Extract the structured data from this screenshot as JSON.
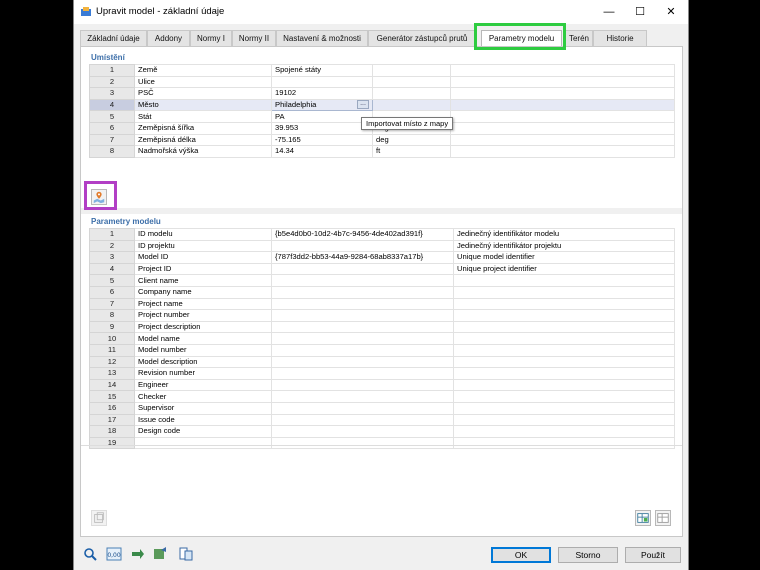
{
  "window": {
    "title": "Upravit model - základní údaje",
    "minimize": "—",
    "maximize": "☐",
    "close": "✕"
  },
  "tabs": [
    {
      "label": "Základní údaje"
    },
    {
      "label": "Addony"
    },
    {
      "label": "Normy I"
    },
    {
      "label": "Normy II"
    },
    {
      "label": "Nastavení & možnosti"
    },
    {
      "label": "Generátor zástupců prutů"
    },
    {
      "label": "Parametry modelu",
      "active": true
    },
    {
      "label": "Terén"
    },
    {
      "label": "Historie"
    }
  ],
  "location": {
    "title": "Umístění",
    "rows": [
      {
        "no": "1",
        "name": "Země",
        "value": "Spojené státy",
        "unit": ""
      },
      {
        "no": "2",
        "name": "Ulice",
        "value": "",
        "unit": ""
      },
      {
        "no": "3",
        "name": "PSČ",
        "value": "19102",
        "unit": ""
      },
      {
        "no": "4",
        "name": "Město",
        "value": "Philadelphia",
        "unit": "",
        "selected": true
      },
      {
        "no": "5",
        "name": "Stát",
        "value": "PA",
        "unit": ""
      },
      {
        "no": "6",
        "name": "Zeměpisná šířka",
        "value": "39.953",
        "unit": "deg"
      },
      {
        "no": "7",
        "name": "Zeměpisná délka",
        "value": "-75.165",
        "unit": "deg"
      },
      {
        "no": "8",
        "name": "Nadmořská výška",
        "value": "14.34",
        "unit": "ft"
      }
    ],
    "tooltip": "Importovat místo z mapy",
    "dots": "..."
  },
  "model_params": {
    "title": "Parametry modelu",
    "rows": [
      {
        "no": "1",
        "name": "ID modelu",
        "value": "{b5e4d0b0-10d2-4b7c-9456-4de402ad391f}",
        "desc": "Jedinečný identifikátor modelu"
      },
      {
        "no": "2",
        "name": "ID projektu",
        "value": "",
        "desc": "Jedinečný identifikátor projektu"
      },
      {
        "no": "3",
        "name": "Model ID",
        "value": "{787f3dd2-bb53-44a9-9284-68ab8337a17b}",
        "desc": "Unique model identifier"
      },
      {
        "no": "4",
        "name": "Project ID",
        "value": "",
        "desc": "Unique project identifier"
      },
      {
        "no": "5",
        "name": "Client name",
        "value": "",
        "desc": ""
      },
      {
        "no": "6",
        "name": "Company name",
        "value": "",
        "desc": ""
      },
      {
        "no": "7",
        "name": "Project name",
        "value": "",
        "desc": ""
      },
      {
        "no": "8",
        "name": "Project number",
        "value": "",
        "desc": ""
      },
      {
        "no": "9",
        "name": "Project description",
        "value": "",
        "desc": ""
      },
      {
        "no": "10",
        "name": "Model name",
        "value": "",
        "desc": ""
      },
      {
        "no": "11",
        "name": "Model number",
        "value": "",
        "desc": ""
      },
      {
        "no": "12",
        "name": "Model description",
        "value": "",
        "desc": ""
      },
      {
        "no": "13",
        "name": "Revision number",
        "value": "",
        "desc": ""
      },
      {
        "no": "14",
        "name": "Engineer",
        "value": "",
        "desc": ""
      },
      {
        "no": "15",
        "name": "Checker",
        "value": "",
        "desc": ""
      },
      {
        "no": "16",
        "name": "Supervisor",
        "value": "",
        "desc": ""
      },
      {
        "no": "17",
        "name": "Issue code",
        "value": "",
        "desc": ""
      },
      {
        "no": "18",
        "name": "Design code",
        "value": "",
        "desc": ""
      },
      {
        "no": "19",
        "name": "",
        "value": "",
        "desc": ""
      }
    ]
  },
  "buttons": {
    "ok": "OK",
    "cancel": "Storno",
    "apply": "Použít"
  },
  "colors": {
    "section_title": "#3d6fa9",
    "highlight_tab": "#2ecc40",
    "highlight_button": "#b23fc5"
  }
}
